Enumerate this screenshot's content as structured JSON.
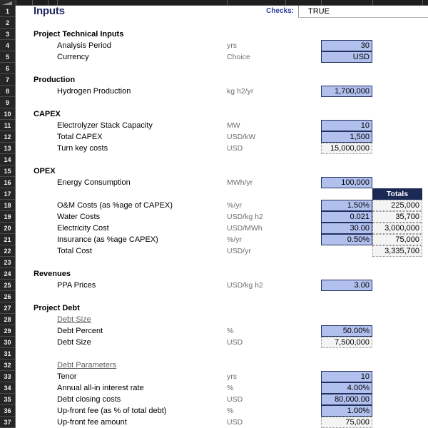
{
  "app": {
    "sheet_title": "Inputs",
    "checks_label": "Checks:",
    "checks_value": "TRUE"
  },
  "columns": {
    "totals_header": "Totals"
  },
  "row_numbers": [
    "1",
    "2",
    "3",
    "4",
    "5",
    "6",
    "7",
    "8",
    "9",
    "10",
    "11",
    "12",
    "13",
    "14",
    "15",
    "16",
    "17",
    "18",
    "19",
    "20",
    "21",
    "22",
    "23",
    "24",
    "25",
    "26",
    "27",
    "28",
    "29",
    "30",
    "31",
    "32",
    "33",
    "34",
    "35",
    "36",
    "37"
  ],
  "rows": [
    {
      "n": 3,
      "kind": "section",
      "label": "Project Technical Inputs",
      "unit": "",
      "value": "",
      "cell": "none",
      "total": ""
    },
    {
      "n": 4,
      "kind": "item",
      "label": "Analysis Period",
      "unit": "yrs",
      "value": "30",
      "cell": "input",
      "total": ""
    },
    {
      "n": 5,
      "kind": "item",
      "label": "Currency",
      "unit": "Choice",
      "value": "USD",
      "cell": "input",
      "total": ""
    },
    {
      "n": 7,
      "kind": "section",
      "label": "Production",
      "unit": "",
      "value": "",
      "cell": "none",
      "total": ""
    },
    {
      "n": 8,
      "kind": "item",
      "label": "Hydrogen Production",
      "unit": "kg h2/yr",
      "value": "1,700,000",
      "cell": "input",
      "total": ""
    },
    {
      "n": 10,
      "kind": "section",
      "label": "CAPEX",
      "unit": "",
      "value": "",
      "cell": "none",
      "total": ""
    },
    {
      "n": 11,
      "kind": "item",
      "label": "Electrolyzer Stack Capacity",
      "unit": "MW",
      "value": "10",
      "cell": "input",
      "total": ""
    },
    {
      "n": 12,
      "kind": "item",
      "label": "Total CAPEX",
      "unit": "USD/kW",
      "value": "1,500",
      "cell": "input",
      "total": ""
    },
    {
      "n": 13,
      "kind": "item",
      "label": "Turn key costs",
      "unit": "USD",
      "value": "15,000,000",
      "cell": "calc",
      "total": ""
    },
    {
      "n": 15,
      "kind": "section",
      "label": "OPEX",
      "unit": "",
      "value": "",
      "cell": "none",
      "total": ""
    },
    {
      "n": 16,
      "kind": "item",
      "label": "Energy Consumption",
      "unit": "MWh/yr",
      "value": "100,000",
      "cell": "input",
      "total": ""
    },
    {
      "n": 18,
      "kind": "item",
      "label": "O&M Costs (as %age of CAPEX)",
      "unit": "%/yr",
      "value": "1.50%",
      "cell": "input",
      "total": "225,000"
    },
    {
      "n": 19,
      "kind": "item",
      "label": "Water Costs",
      "unit": "USD/kg h2",
      "value": "0.021",
      "cell": "input",
      "total": "35,700"
    },
    {
      "n": 20,
      "kind": "item",
      "label": "Electricity Cost",
      "unit": "USD/MWh",
      "value": "30.00",
      "cell": "input",
      "total": "3,000,000"
    },
    {
      "n": 21,
      "kind": "item",
      "label": "Insurance (as %age CAPEX)",
      "unit": "%/yr",
      "value": "0.50%",
      "cell": "input",
      "total": "75,000"
    },
    {
      "n": 22,
      "kind": "item",
      "label": "Total Cost",
      "unit": "USD/yr",
      "value": "",
      "cell": "none",
      "total": "3,335,700"
    },
    {
      "n": 24,
      "kind": "section",
      "label": "Revenues",
      "unit": "",
      "value": "",
      "cell": "none",
      "total": ""
    },
    {
      "n": 25,
      "kind": "item",
      "label": "PPA Prices",
      "unit": "USD/kg h2",
      "value": "3.00",
      "cell": "input",
      "total": ""
    },
    {
      "n": 27,
      "kind": "section",
      "label": "Project Debt",
      "unit": "",
      "value": "",
      "cell": "none",
      "total": ""
    },
    {
      "n": 28,
      "kind": "subhead",
      "label": "Debt Size",
      "unit": "",
      "value": "",
      "cell": "none",
      "total": ""
    },
    {
      "n": 29,
      "kind": "item",
      "label": "Debt Percent",
      "unit": "%",
      "value": "50.00%",
      "cell": "input",
      "total": ""
    },
    {
      "n": 30,
      "kind": "item",
      "label": "Debt Size",
      "unit": "USD",
      "value": "7,500,000",
      "cell": "calc",
      "total": ""
    },
    {
      "n": 32,
      "kind": "subhead",
      "label": "Debt Parameters",
      "unit": "",
      "value": "",
      "cell": "none",
      "total": ""
    },
    {
      "n": 33,
      "kind": "item",
      "label": "Tenor",
      "unit": "yrs",
      "value": "10",
      "cell": "input",
      "total": ""
    },
    {
      "n": 34,
      "kind": "item",
      "label": "Annual all-in interest rate",
      "unit": "%",
      "value": "4.00%",
      "cell": "input",
      "total": ""
    },
    {
      "n": 35,
      "kind": "item",
      "label": "Debt closing costs",
      "unit": "USD",
      "value": "80,000.00",
      "cell": "input",
      "total": ""
    },
    {
      "n": 36,
      "kind": "item",
      "label": "Up-front fee (as % of total debt)",
      "unit": "%",
      "value": "1.00%",
      "cell": "input",
      "total": ""
    },
    {
      "n": 37,
      "kind": "item",
      "label": "Up-front fee amount",
      "unit": "USD",
      "value": "75,000",
      "cell": "calc",
      "total": ""
    }
  ],
  "totals_header_row": 17,
  "colors": {
    "input_fill": "#b2c0ee",
    "input_border": "#21315e",
    "calc_fill": "#f4f4f4",
    "totals_fill": "#1b2a55",
    "title_color": "#1f2a63",
    "checks_color": "#2b3f9e",
    "gutter_bg": "#1e1e1e"
  }
}
